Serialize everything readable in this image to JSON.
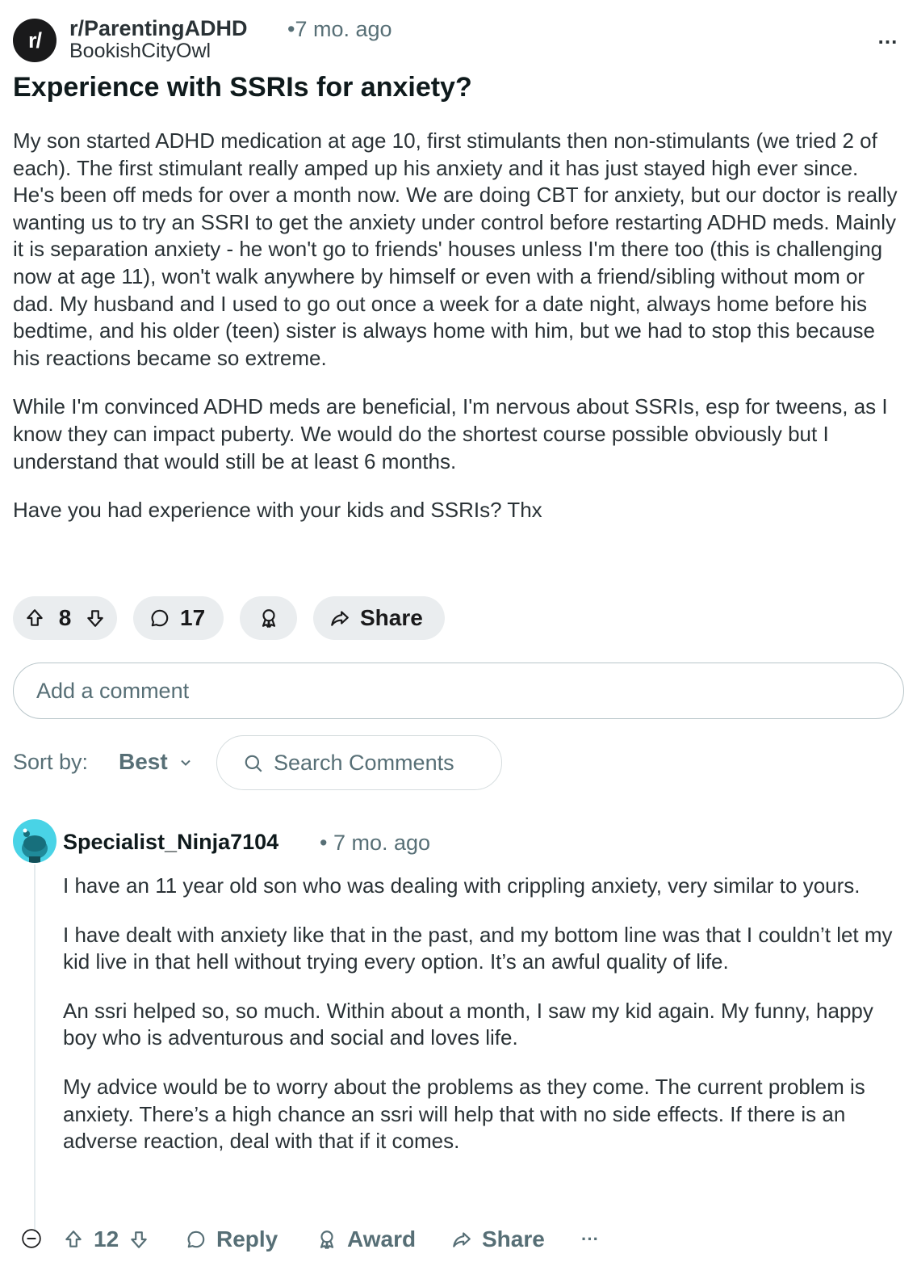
{
  "post": {
    "avatar_text": "r/",
    "subreddit": "r/ParentingADHD",
    "time_sep": "•",
    "time": "7 mo. ago",
    "author": "BookishCityOwl",
    "more": "…",
    "title": "Experience with SSRIs for anxiety?",
    "paragraphs": [
      "My son started ADHD medication at age 10, first stimulants then non-stimulants (we tried 2 of each). The first stimulant really amped up his anxiety and it has just stayed high ever since. He's been off meds for over a month now. We are doing CBT for anxiety, but our doctor is really wanting us to try an SSRI to get the anxiety under control before restarting ADHD meds. Mainly it is separation anxiety - he won't go to friends' houses unless I'm there too (this is challenging now at age 11), won't walk anywhere by himself or even with a friend/sibling without mom or dad. My husband and I used to go out once a week for a date night, always home before his bedtime, and his older (teen) sister is always home with him, but we had to stop this because his reactions became so extreme.",
      "While I'm convinced ADHD meds are beneficial, I'm nervous about SSRIs, esp for tweens, as I know they can impact puberty. We would do the shortest course possible obviously but I understand that would still be at least 6 months.",
      "Have you had experience with your kids and SSRIs? Thx"
    ],
    "votes": "8",
    "comments": "17",
    "share_label": "Share"
  },
  "comment_input": {
    "placeholder": "Add a comment"
  },
  "sort": {
    "label": "Sort by:",
    "value": "Best",
    "search_placeholder": "Search Comments"
  },
  "comment": {
    "user": "Specialist_Ninja7104",
    "time": "• 7 mo. ago",
    "paragraphs": [
      "I have an 11 year old son who was dealing with crippling anxiety, very similar to yours.",
      "I have dealt with anxiety like that in the past, and my bottom line was that I couldn’t let my kid live in that hell without trying every option. It’s an awful quality of life.",
      "An ssri helped so, so much. Within about a month, I saw my kid again. My funny, happy boy who is adventurous and social and loves life.",
      "My advice would be to worry about the problems as they come. The current problem is anxiety. There’s a high chance an ssri will help that with no side effects. If there is an adverse reaction, deal with that if it comes."
    ],
    "votes": "12",
    "reply_label": "Reply",
    "award_label": "Award",
    "share_label": "Share",
    "more": "···"
  },
  "icons": {
    "upvote": "arrow-up-icon",
    "downvote": "arrow-down-icon",
    "comment": "speech-bubble-icon",
    "award": "award-ribbon-icon",
    "share": "share-arrow-icon",
    "search": "magnifier-icon",
    "collapse": "minus-circle-icon"
  }
}
